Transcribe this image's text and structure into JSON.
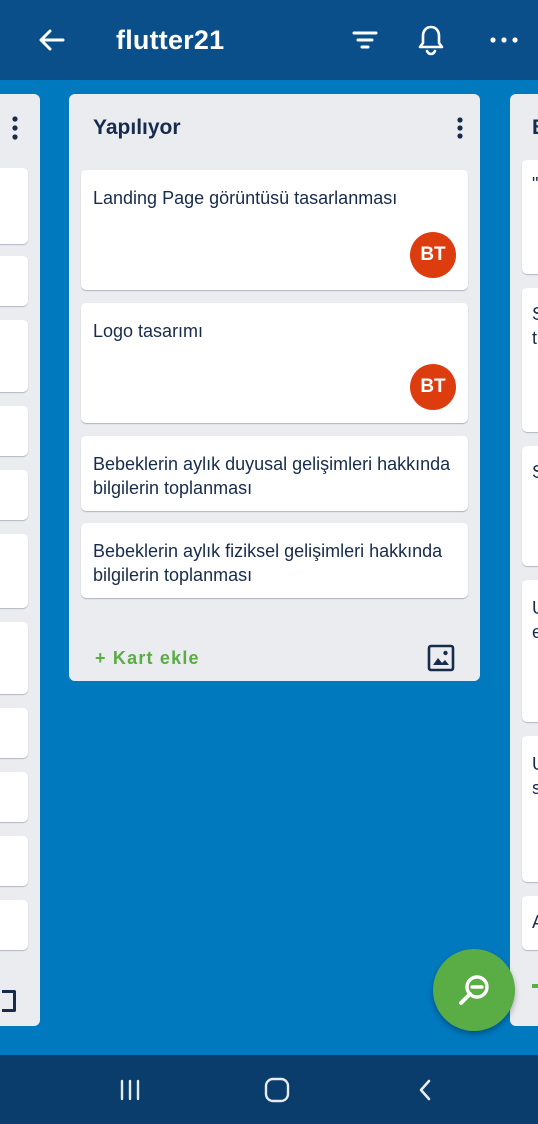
{
  "appbar": {
    "title": "flutter21",
    "icons": [
      "back-arrow-icon",
      "filter-icon",
      "bell-icon",
      "more-icon"
    ]
  },
  "main_list": {
    "title": "Yapılıyor",
    "cards": [
      {
        "text": "Landing Page görüntüsü tasarlanması",
        "member": "BT"
      },
      {
        "text": "Logo tasarımı",
        "member": "BT"
      },
      {
        "text": "Bebeklerin aylık duyusal gelişimleri hakkında bilgilerin toplanması"
      },
      {
        "text": "Bebeklerin aylık fiziksel gelişimleri hakkında bilgilerin toplanması"
      }
    ],
    "add_card_label": "+ Kart ekle"
  },
  "right_list": {
    "title_fragment": "B",
    "card_fragments": [
      "\"",
      "S\nt",
      "S",
      "U\ne",
      "U\ns",
      "A"
    ]
  },
  "colors": {
    "board_bg": "#0079BF",
    "appbar_bg": "#0B4F8A",
    "list_bg": "#EBECF0",
    "avatar": "#DD3C0E",
    "accent_green": "#5AAC44",
    "navbar_bg": "#0A3D6B"
  },
  "fab": {
    "icon": "zoom-search-icon"
  },
  "navbar": {
    "icons": [
      "recent-apps-icon",
      "home-icon",
      "back-icon"
    ]
  }
}
